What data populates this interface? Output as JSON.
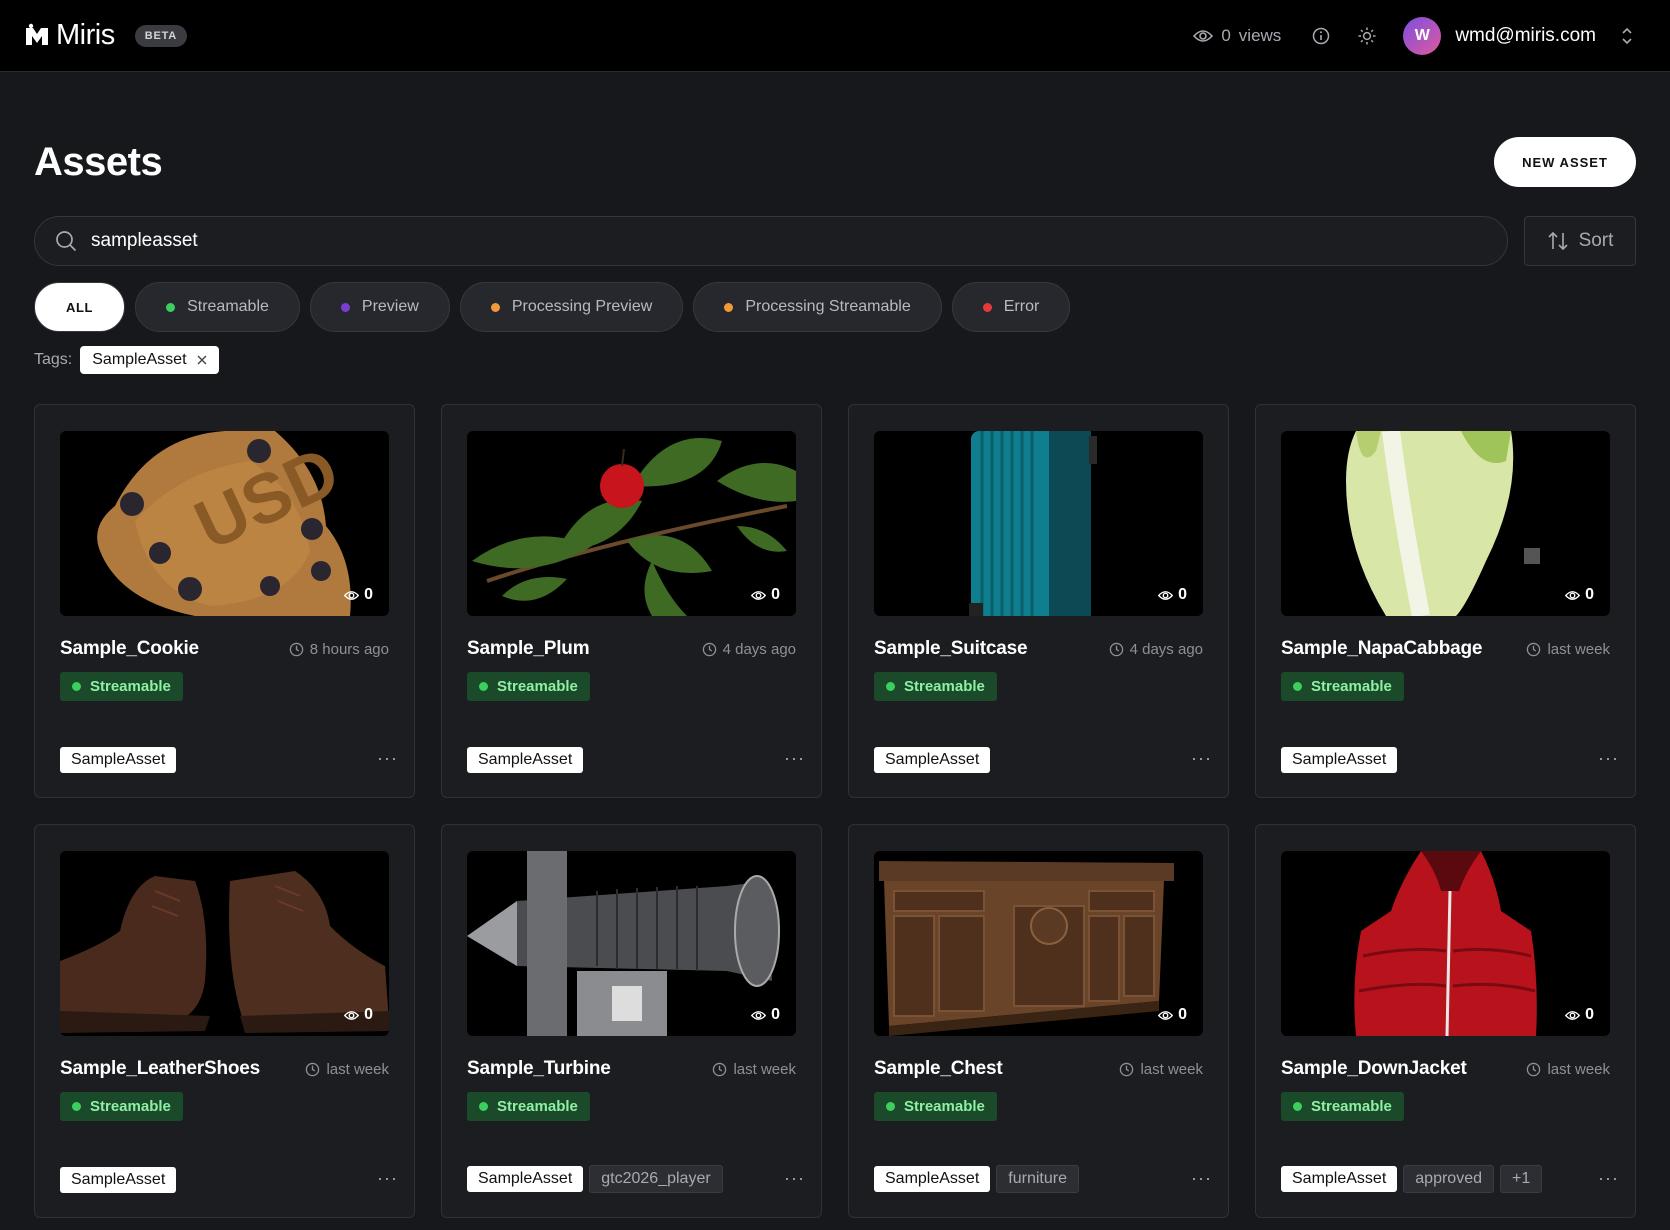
{
  "app": {
    "name": "Miris",
    "badge": "BETA"
  },
  "topbar": {
    "views_count": "0",
    "views_label": "views",
    "avatar_initial": "W",
    "user_email": "wmd@miris.com"
  },
  "header": {
    "title": "Assets",
    "new_asset_label": "NEW ASSET"
  },
  "search": {
    "value": "sampleasset",
    "sort_label": "Sort"
  },
  "filters": [
    {
      "label": "ALL",
      "active": true
    },
    {
      "label": "Streamable",
      "color": "#3ccf5e"
    },
    {
      "label": "Preview",
      "color": "#7a3fd0"
    },
    {
      "label": "Processing Preview",
      "color": "#f0993a"
    },
    {
      "label": "Processing Streamable",
      "color": "#f0993a"
    },
    {
      "label": "Error",
      "color": "#e53a3a"
    }
  ],
  "tags_filter": {
    "label": "Tags:",
    "active_tag": "SampleAsset"
  },
  "assets": [
    {
      "name": "Sample_Cookie",
      "time": "8 hours ago",
      "views": "0",
      "status": "Streamable",
      "tags": [
        "SampleAsset"
      ]
    },
    {
      "name": "Sample_Plum",
      "time": "4 days ago",
      "views": "0",
      "status": "Streamable",
      "tags": [
        "SampleAsset"
      ]
    },
    {
      "name": "Sample_Suitcase",
      "time": "4 days ago",
      "views": "0",
      "status": "Streamable",
      "tags": [
        "SampleAsset"
      ]
    },
    {
      "name": "Sample_NapaCabbage",
      "time": "last week",
      "views": "0",
      "status": "Streamable",
      "tags": [
        "SampleAsset"
      ]
    },
    {
      "name": "Sample_LeatherShoes",
      "time": "last week",
      "views": "0",
      "status": "Streamable",
      "tags": [
        "SampleAsset"
      ]
    },
    {
      "name": "Sample_Turbine",
      "time": "last week",
      "views": "0",
      "status": "Streamable",
      "tags": [
        "SampleAsset",
        "gtc2026_player"
      ]
    },
    {
      "name": "Sample_Chest",
      "time": "last week",
      "views": "0",
      "status": "Streamable",
      "tags": [
        "SampleAsset",
        "furniture"
      ]
    },
    {
      "name": "Sample_DownJacket",
      "time": "last week",
      "views": "0",
      "status": "Streamable",
      "tags": [
        "SampleAsset",
        "approved",
        "+1"
      ]
    }
  ],
  "more_label": "···",
  "status_color": "#3ccf5e"
}
